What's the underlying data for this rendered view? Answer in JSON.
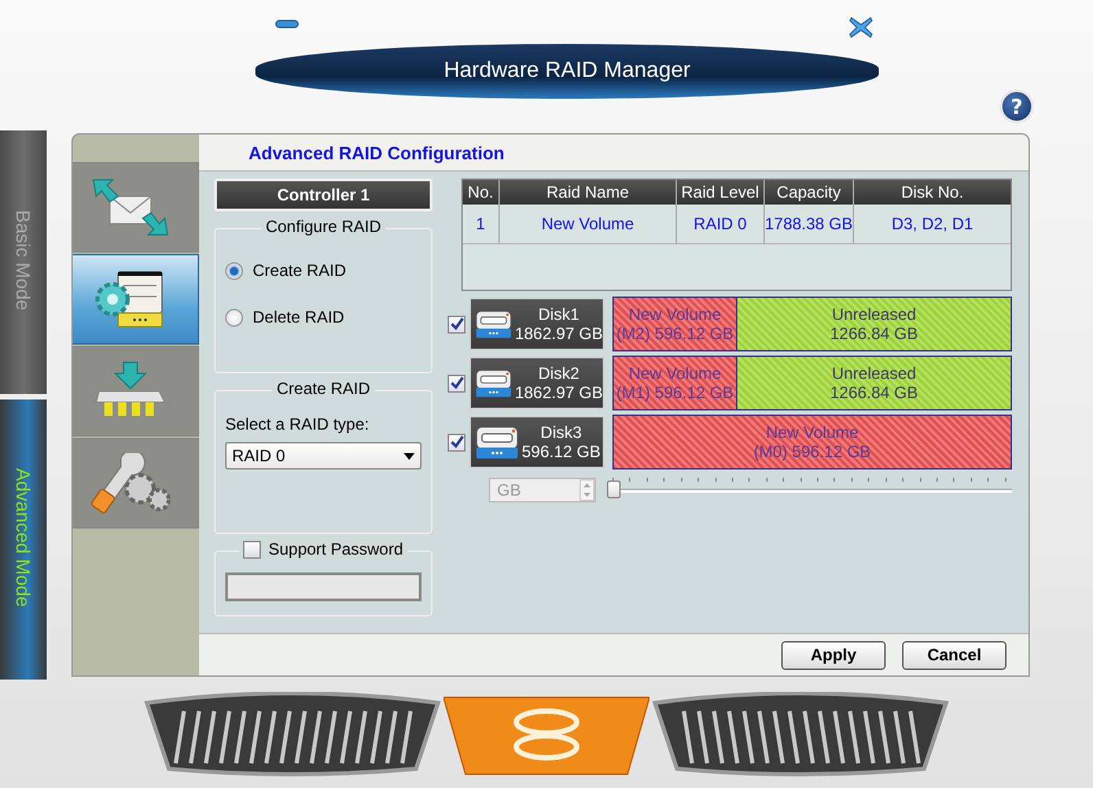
{
  "window": {
    "title": "Hardware RAID Manager",
    "help": "?"
  },
  "modes": [
    {
      "label": "Basic Mode",
      "selected": false
    },
    {
      "label": "Advanced Mode",
      "selected": true
    }
  ],
  "nav_tabs": [
    {
      "kind": "transfer",
      "selected": false
    },
    {
      "kind": "configure",
      "selected": true
    },
    {
      "kind": "install",
      "selected": false
    },
    {
      "kind": "tools",
      "selected": false
    }
  ],
  "heading": "Advanced RAID Configuration",
  "controller": "Controller 1",
  "configure_raid": {
    "legend": "Configure RAID",
    "options": [
      {
        "label": "Create RAID",
        "selected": true
      },
      {
        "label": "Delete RAID",
        "selected": false
      }
    ]
  },
  "create_raid": {
    "legend": "Create RAID",
    "type_label": "Select a RAID type:",
    "type_value": "RAID 0"
  },
  "password": {
    "label": "Support Password",
    "checked": false
  },
  "table": {
    "columns": [
      "No.",
      "Raid Name",
      "Raid Level",
      "Capacity",
      "Disk No."
    ],
    "rows": [
      [
        "1",
        "New Volume",
        "RAID 0",
        "1788.38 GB",
        "D3, D2, D1"
      ]
    ]
  },
  "disks": [
    {
      "name": "Disk1",
      "size": "1862.97 GB",
      "checked": true,
      "segments": [
        {
          "kind": "volume",
          "line1": "New Volume",
          "line2": "(M2) 596.12 GB"
        },
        {
          "kind": "unreleased",
          "line1": "Unreleased",
          "line2": "1266.84 GB"
        }
      ]
    },
    {
      "name": "Disk2",
      "size": "1862.97 GB",
      "checked": true,
      "segments": [
        {
          "kind": "volume",
          "line1": "New Volume",
          "line2": "(M1) 596.12 GB"
        },
        {
          "kind": "unreleased",
          "line1": "Unreleased",
          "line2": "1266.84 GB"
        }
      ]
    },
    {
      "name": "Disk3",
      "size": "596.12 GB",
      "checked": true,
      "segments": [
        {
          "kind": "volume",
          "line1": "New Volume",
          "line2": "(M0) 596.12 GB"
        }
      ]
    }
  ],
  "size_unit": {
    "value": "GB",
    "disabled": true
  },
  "size_slider": {
    "level": 0
  },
  "buttons": [
    {
      "label": "Apply"
    },
    {
      "label": "Cancel"
    }
  ]
}
